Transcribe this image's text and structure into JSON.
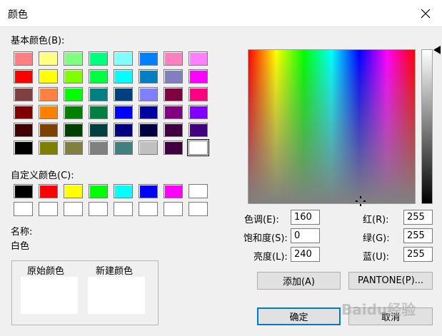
{
  "window": {
    "title": "颜色"
  },
  "basic": {
    "label": "基本颜色(B):",
    "colors": [
      "#ff8080",
      "#ffff80",
      "#80ff80",
      "#00ff80",
      "#80ffff",
      "#0080ff",
      "#ff80c0",
      "#ff80ff",
      "#ff0000",
      "#ffff00",
      "#80ff00",
      "#00ff40",
      "#00ffff",
      "#0080c0",
      "#8080c0",
      "#ff00ff",
      "#804040",
      "#ff8040",
      "#00ff00",
      "#008080",
      "#004080",
      "#8080ff",
      "#800040",
      "#ff0080",
      "#800000",
      "#ff8000",
      "#008000",
      "#008040",
      "#0000ff",
      "#0000a0",
      "#800080",
      "#8000ff",
      "#400000",
      "#804000",
      "#004000",
      "#004040",
      "#000080",
      "#000040",
      "#400040",
      "#400080",
      "#000000",
      "#808000",
      "#808040",
      "#808080",
      "#408080",
      "#c0c0c0",
      "#400040",
      "#ffffff"
    ]
  },
  "custom": {
    "label": "自定义颜色(C):",
    "colors": [
      "#000000",
      "#ff0000",
      "#ffff00",
      "#00ff00",
      "#00ffff",
      "#0000ff",
      "#ff00ff",
      "#ffffff",
      "#ffffff",
      "#ffffff",
      "#ffffff",
      "#ffffff",
      "#ffffff",
      "#ffffff",
      "#ffffff",
      "#ffffff"
    ]
  },
  "name": {
    "label": "名称:",
    "value": "白色"
  },
  "preview": {
    "original": "原始颜色",
    "new": "新建颜色"
  },
  "fields": {
    "hue_label": "色调(E):",
    "hue": "160",
    "sat_label": "饱和度(S):",
    "sat": "0",
    "lum_label": "亮度(L):",
    "lum": "240",
    "red_label": "红(R):",
    "red": "255",
    "green_label": "绿(G):",
    "green": "255",
    "blue_label": "蓝(U):",
    "blue": "255"
  },
  "buttons": {
    "add": "添加(A)",
    "pantone": "PANTONE(P)...",
    "ok": "确定",
    "cancel": "取消"
  },
  "watermark": "Baidu经验"
}
